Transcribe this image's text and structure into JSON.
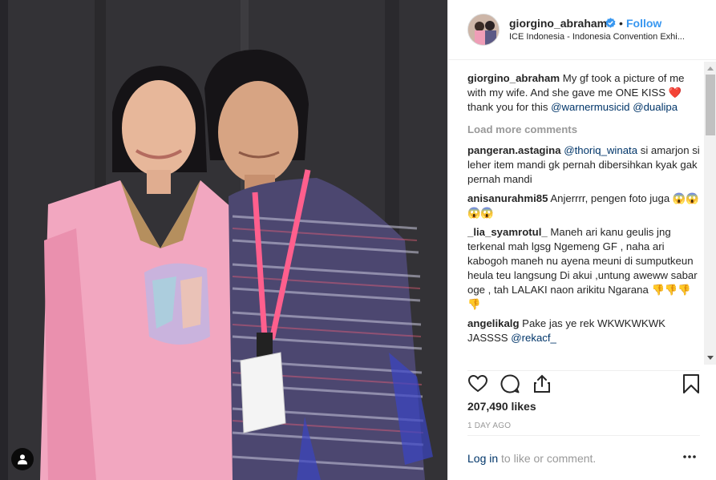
{
  "header": {
    "username": "giorgino_abraham",
    "separator": "•",
    "follow_label": "Follow",
    "location": "ICE Indonesia - Indonesia Convention Exhi..."
  },
  "caption": {
    "username": "giorgino_abraham",
    "text_before": "My gf took a picture of me with my wife. And she gave me ONE KISS",
    "emoji": "❤️",
    "text_after": "thank you for this",
    "mention1": "@warnermusicid",
    "mention2": "@dualipa"
  },
  "load_more_label": "Load more comments",
  "comments": [
    {
      "username": "pangeran.astagina",
      "mention": "@thoriq_winata",
      "text": "si amarjon si leher item mandi gk pernah dibersihkan kyak gak pernah mandi"
    },
    {
      "username": "anisanurahmi85",
      "text": "Anjerrrr, pengen foto juga",
      "emojis": "😱😱😱😱"
    },
    {
      "username": "_lia_syamrotul_",
      "text": "Maneh ari kanu geulis jng terkenal mah lgsg Ngemeng GF , naha ari kabogoh maneh nu ayena meuni di sumputkeun heula teu langsung Di akui ,untung aweww sabar oge , tah LALAKI naon arikitu Ngarana",
      "emojis": "👎👎👎👎"
    },
    {
      "username": "angelikalg",
      "text": "Pake jas ye rek WKWKWKWK JASSSS",
      "mention": "@rekacf_"
    }
  ],
  "likes": "207,490 likes",
  "time_ago": "1 DAY AGO",
  "footer": {
    "login_link": "Log in",
    "login_rest": " to like or comment."
  },
  "icons": [
    "verified-badge-icon",
    "heart-icon",
    "comment-icon",
    "share-icon",
    "bookmark-icon",
    "more-options-icon",
    "user-tag-icon"
  ],
  "colors": {
    "link_blue": "#3897f0",
    "mention_navy": "#003569",
    "muted_gray": "#999999",
    "verified_blue": "#3897f0"
  }
}
